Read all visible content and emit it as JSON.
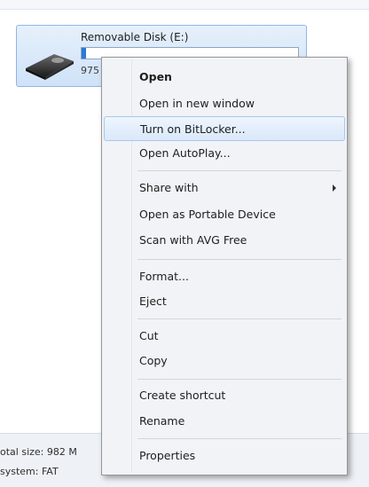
{
  "drive": {
    "name": "Removable Disk (E:)",
    "size_text": "975",
    "usage_fraction": 0.02
  },
  "details": {
    "total_size": "otal size: 982 M",
    "file_system": "system: FAT"
  },
  "context_menu": {
    "items": [
      {
        "label": "Open",
        "bold": true
      },
      {
        "label": "Open in new window"
      },
      {
        "label": "Turn on BitLocker...",
        "highlighted": true
      },
      {
        "label": "Open AutoPlay..."
      },
      {
        "label": "Share with",
        "submenu": true
      },
      {
        "label": "Open as Portable Device"
      },
      {
        "label": "Scan with AVG Free"
      },
      {
        "label": "Format..."
      },
      {
        "label": "Eject"
      },
      {
        "label": "Cut"
      },
      {
        "label": "Copy"
      },
      {
        "label": "Create shortcut"
      },
      {
        "label": "Rename"
      },
      {
        "label": "Properties"
      }
    ]
  },
  "colors": {
    "highlight_border": "#a8c8ee",
    "tile_border": "#8fb6e6",
    "menu_background": "#f1f3f6"
  }
}
